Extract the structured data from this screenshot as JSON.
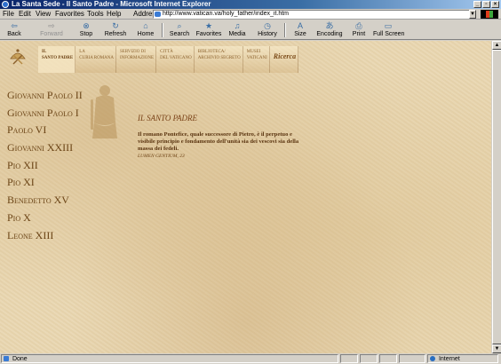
{
  "window": {
    "title": "La Santa Sede - Il Santo Padre - Microsoft Internet Explorer",
    "buttons": {
      "minimize": "_",
      "maximize": "▫",
      "close": "×"
    }
  },
  "menu": {
    "file": "File",
    "edit": "Edit",
    "view": "View",
    "favorites": "Favorites",
    "tools": "Tools",
    "help": "Help"
  },
  "address": {
    "label": "Address",
    "url": "http://www.vatican.va/holy_father/index_it.htm"
  },
  "toolbar": {
    "back": "Back",
    "forward": "Forward",
    "stop": "Stop",
    "refresh": "Refresh",
    "home": "Home",
    "search": "Search",
    "favorites": "Favorites",
    "media": "Media",
    "history": "History",
    "size": "Size",
    "encoding": "Encoding",
    "print": "Print",
    "fullscreen": "Full Screen"
  },
  "nav": {
    "tabs": [
      {
        "line1": "Il",
        "line2": "Santo Padre"
      },
      {
        "line1": "La",
        "line2": "Curia Romana"
      },
      {
        "line1": "Servizio di",
        "line2": "Informazione"
      },
      {
        "line1": "Città",
        "line2": "del Vaticano"
      },
      {
        "line1": "Biblioteca/",
        "line2": "Archivio segreto"
      },
      {
        "line1": "Musei",
        "line2": "Vaticani"
      }
    ],
    "search_label": "Ricerca"
  },
  "popes": [
    "Giovanni Paolo II",
    "Giovanni Paolo I",
    "Paolo VI",
    "Giovanni XXIII",
    "Pio XII",
    "Pio XI",
    "Benedetto XV",
    "Pio X",
    "Leone XIII"
  ],
  "main": {
    "title": "IL SANTO PADRE",
    "quote": "Il romano Pontefice, quale successore di Pietro, è il perpetuo e visibile principio e fondamento dell'unità sia dei vescovi sia della massa dei fedeli.",
    "quote_source": "LUMEN GENTIUM, 23"
  },
  "status": {
    "text": "Done",
    "zone": "Internet"
  }
}
